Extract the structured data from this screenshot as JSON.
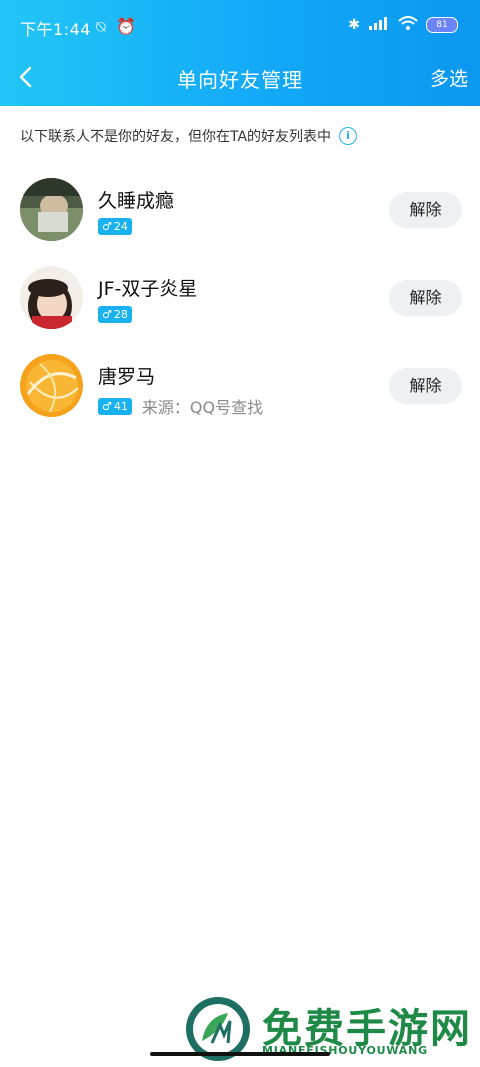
{
  "status_bar": {
    "time": "下午1:44",
    "battery": "81"
  },
  "nav": {
    "title": "单向好友管理",
    "multi_select": "多选"
  },
  "notice": "以下联系人不是你的好友，但你在TA的好友列表中",
  "contacts": [
    {
      "name": "久睡成瘾",
      "gender": "♂",
      "age": "24",
      "source": "",
      "action": "解除"
    },
    {
      "name": "JF-双子炎星",
      "gender": "♂",
      "age": "28",
      "source": "",
      "action": "解除"
    },
    {
      "name": "唐罗马",
      "gender": "♂",
      "age": "41",
      "source": "来源：QQ号查找",
      "action": "解除"
    }
  ],
  "watermark": {
    "title": "免费手游网",
    "subtitle": "MIANFEISHOUYOUWANG"
  },
  "colors": {
    "header_start": "#22c6f6",
    "header_end": "#0b97ef",
    "badge": "#17b2ef",
    "button_bg": "#eef0f4"
  }
}
